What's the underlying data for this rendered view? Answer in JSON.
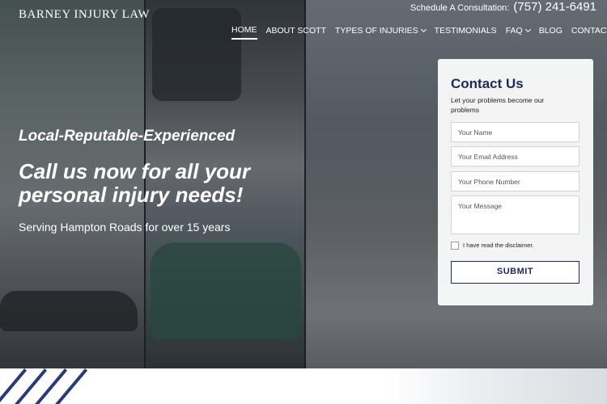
{
  "header": {
    "logo": "BARNEY INJURY LAW",
    "consult_label": "Schedule A Consultation:",
    "phone": "(757) 241-6491"
  },
  "nav": {
    "home": "HOME",
    "about": "ABOUT SCOTT",
    "injuries": "TYPES OF INJURIES",
    "testimonials": "TESTIMONIALS",
    "faq": "FAQ",
    "blog": "BLOG",
    "contact": "CONTACT US"
  },
  "hero": {
    "tagline": "Local-Reputable-Experienced",
    "headline": "Call us now for all your personal injury needs!",
    "serving": "Serving Hampton Roads for over 15 years"
  },
  "form": {
    "title": "Contact Us",
    "subtitle": "Let your problems become our problems",
    "name_placeholder": "Your Name",
    "email_placeholder": "Your Email Address",
    "phone_placeholder": "Your Phone Number",
    "message_placeholder": "Your Message",
    "disclaimer_label": "I have read the disclaimer.",
    "submit_label": "SUBMIT"
  },
  "colors": {
    "brand_navy": "#1f2a5c",
    "nav_text": "#ffffff"
  }
}
